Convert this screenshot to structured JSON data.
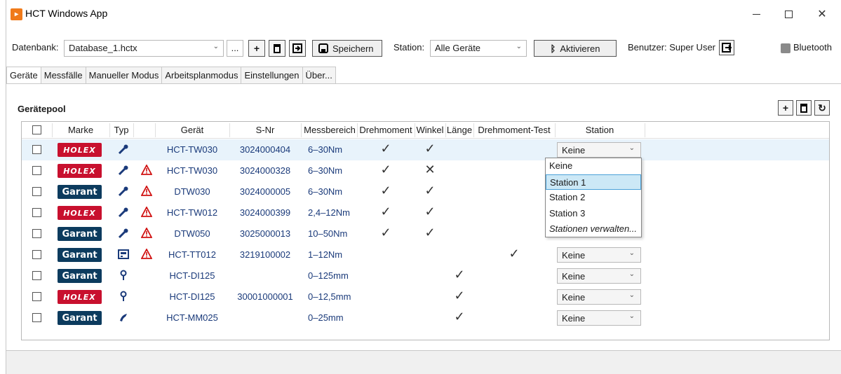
{
  "window": {
    "title": "HCT Windows App"
  },
  "toolbar": {
    "database_label": "Datenbank:",
    "database_value": "Database_1.hctx",
    "browse_label": "...",
    "save_label": "Speichern",
    "station_label": "Station:",
    "station_value": "Alle Geräte",
    "activate_label": "Aktivieren",
    "user_label": "Benutzer: Super User",
    "bluetooth_label": "Bluetooth"
  },
  "tabs": [
    "Geräte",
    "Messfälle",
    "Manueller Modus",
    "Arbeitsplanmodus",
    "Einstellungen",
    "Über..."
  ],
  "pool": {
    "title": "Gerätepool"
  },
  "grid": {
    "headers": [
      "Marke",
      "Typ",
      "Gerät",
      "S-Nr",
      "Messbereich",
      "Drehmoment",
      "Winkel",
      "Länge",
      "Drehmoment-Test",
      "Station"
    ],
    "rows": [
      {
        "brand": "HOLEX",
        "type": "wrench",
        "warn": false,
        "device": "HCT-TW030",
        "serial": "3024000404",
        "range": "6–30Nm",
        "torque": "✓",
        "angle": "✓",
        "length": "",
        "torque_test": "",
        "station": "Keine"
      },
      {
        "brand": "HOLEX",
        "type": "wrench",
        "warn": true,
        "device": "HCT-TW030",
        "serial": "3024000328",
        "range": "6–30Nm",
        "torque": "✓",
        "angle": "✕",
        "length": "",
        "torque_test": "",
        "station": ""
      },
      {
        "brand": "Garant",
        "type": "wrench",
        "warn": true,
        "device": "DTW030",
        "serial": "3024000005",
        "range": "6–30Nm",
        "torque": "✓",
        "angle": "✓",
        "length": "",
        "torque_test": "",
        "station": ""
      },
      {
        "brand": "HOLEX",
        "type": "wrench",
        "warn": true,
        "device": "HCT-TW012",
        "serial": "3024000399",
        "range": "2,4–12Nm",
        "torque": "✓",
        "angle": "✓",
        "length": "",
        "torque_test": "",
        "station": ""
      },
      {
        "brand": "Garant",
        "type": "wrench",
        "warn": true,
        "device": "DTW050",
        "serial": "3025000013",
        "range": "10–50Nm",
        "torque": "✓",
        "angle": "✓",
        "length": "",
        "torque_test": "",
        "station": ""
      },
      {
        "brand": "Garant",
        "type": "tester",
        "warn": true,
        "device": "HCT-TT012",
        "serial": "3219100002",
        "range": "1–12Nm",
        "torque": "",
        "angle": "",
        "length": "",
        "torque_test": "✓",
        "station": "Keine"
      },
      {
        "brand": "Garant",
        "type": "indicator",
        "warn": false,
        "device": "HCT-DI125",
        "serial": "",
        "range": "0–125mm",
        "torque": "",
        "angle": "",
        "length": "✓",
        "torque_test": "",
        "station": "Keine"
      },
      {
        "brand": "HOLEX",
        "type": "indicator",
        "warn": false,
        "device": "HCT-DI125",
        "serial": "30001000001",
        "range": "0–12,5mm",
        "torque": "",
        "angle": "",
        "length": "✓",
        "torque_test": "",
        "station": "Keine"
      },
      {
        "brand": "Garant",
        "type": "micrometer",
        "warn": false,
        "device": "HCT-MM025",
        "serial": "",
        "range": "0–25mm",
        "torque": "",
        "angle": "",
        "length": "✓",
        "torque_test": "",
        "station": "Keine"
      }
    ]
  },
  "station_dropdown": {
    "options": [
      "Keine",
      "Station 1",
      "Station 2",
      "Station 3",
      "Stationen verwalten..."
    ],
    "highlighted": "Station 1"
  },
  "colors": {
    "holex": "#c8102e",
    "garant": "#0c3b5e",
    "warning": "#d01010",
    "selection": "#cce8f6"
  }
}
